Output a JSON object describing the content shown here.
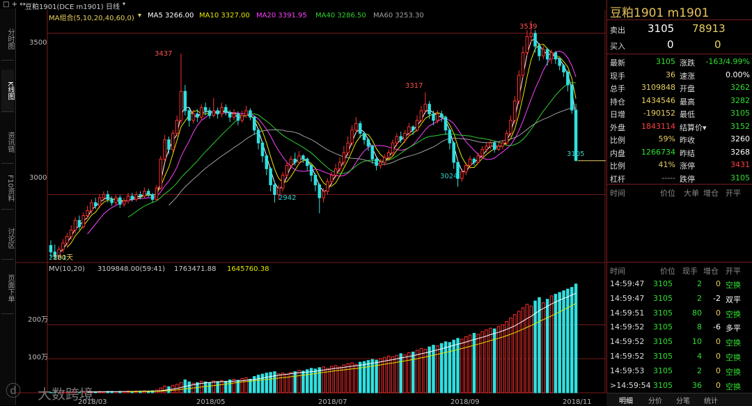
{
  "window": {
    "title": "豆粕1901(DCE m1901)",
    "period": "日线",
    "controls": [
      "□",
      "+",
      "↔"
    ]
  },
  "left_tabs": [
    "分时图",
    "K线图",
    "资讯链",
    "F10资料",
    "讨论区",
    "页面下单"
  ],
  "ma_legend": {
    "group": "MA组合(5,10,20,40,60,0)",
    "items": [
      {
        "label": "MA5 3266.00",
        "color": "#ffffff"
      },
      {
        "label": "MA10 3327.00",
        "color": "#e6e600"
      },
      {
        "label": "MA20 3391.95",
        "color": "#ff40ff"
      },
      {
        "label": "MA40 3286.50",
        "color": "#30d030"
      },
      {
        "label": "MA60 3253.30",
        "color": "#a0a0a0"
      }
    ]
  },
  "price_axis": [
    "3500",
    "3000"
  ],
  "volume_axis": [
    "200万",
    "100万"
  ],
  "x_axis": [
    "2018/03",
    "2018/05",
    "2018/07",
    "2018/09",
    "2018/11"
  ],
  "annotations": {
    "max": "3539",
    "high1": "3437",
    "high2": "3317",
    "low1": "2942",
    "low2": "3024",
    "last": "3105",
    "start": "2801",
    "overlay": "180天"
  },
  "vol_legend": {
    "title": "MV(10,20)",
    "v1": "3109848.00(59:41)",
    "v2": "1763471.88",
    "v3": "1645760.38"
  },
  "panel": {
    "title": "豆粕1901  m1901",
    "sell": {
      "label": "卖出",
      "price": "3105",
      "qty": "78913"
    },
    "buy": {
      "label": "买入",
      "price": "0",
      "qty": "0"
    },
    "stats": [
      {
        "l1": "最新",
        "v1": "3105",
        "c1": "#30e030",
        "l2": "涨跌",
        "v2": "-163/4.99%",
        "c2": "#30e030"
      },
      {
        "l1": "现手",
        "v1": "36",
        "c1": "#e8d060",
        "l2": "速涨",
        "v2": "0.00%",
        "c2": "#ffffff"
      },
      {
        "l1": "总手",
        "v1": "3109848",
        "c1": "#e8d060",
        "l2": "开盘",
        "v2": "3262",
        "c2": "#30e030"
      },
      {
        "l1": "持仓",
        "v1": "1434546",
        "c1": "#e8d060",
        "l2": "最高",
        "v2": "3282",
        "c2": "#30e030"
      },
      {
        "l1": "日增",
        "v1": "-190152",
        "c1": "#e8d060",
        "l2": "最低",
        "v2": "3105",
        "c2": "#30e030"
      },
      {
        "l1": "外盘",
        "v1": "1843114",
        "c1": "#ff4040",
        "l2": "结算价▾",
        "v2": "3152",
        "c2": "#30e030"
      },
      {
        "l1": "比例",
        "v1": "59%",
        "c1": "#e8d060",
        "l2": "昨收",
        "v2": "3260",
        "c2": "#ffffff"
      },
      {
        "l1": "内盘",
        "v1": "1266734",
        "c1": "#30e030",
        "l2": "昨结",
        "v2": "3268",
        "c2": "#ffffff"
      },
      {
        "l1": "比例",
        "v1": "41%",
        "c1": "#e8d060",
        "l2": "涨停",
        "v2": "3431",
        "c2": "#ff4040"
      },
      {
        "l1": "杠杆",
        "v1": "-----",
        "c1": "#aaaaaa",
        "l2": "跌停",
        "v2": "3105",
        "c2": "#30e030"
      }
    ],
    "big_header": [
      "时间",
      "价位",
      "大单",
      "增仓",
      "开平"
    ],
    "tick_header": [
      "时间",
      "价位",
      "现手",
      "增仓",
      "开平"
    ],
    "ticks": [
      {
        "time": "14:59:47",
        "price": "3105",
        "qty": "2",
        "oi": "0",
        "type": "空换",
        "oc": "#e8d060",
        "tc": "#30e030"
      },
      {
        "time": "14:59:47",
        "price": "3105",
        "qty": "2",
        "oi": "-2",
        "type": "双平",
        "oc": "#ffffff",
        "tc": "#ffffff"
      },
      {
        "time": "14:59:51",
        "price": "3105",
        "qty": "80",
        "oi": "0",
        "type": "空换",
        "oc": "#e8d060",
        "tc": "#30e030"
      },
      {
        "time": "14:59:52",
        "price": "3105",
        "qty": "8",
        "oi": "-6",
        "type": "多平",
        "oc": "#ffffff",
        "tc": "#ffffff"
      },
      {
        "time": "14:59:52",
        "price": "3105",
        "qty": "10",
        "oi": "0",
        "type": "空换",
        "oc": "#e8d060",
        "tc": "#30e030"
      },
      {
        "time": "14:59:52",
        "price": "3105",
        "qty": "4",
        "oi": "0",
        "type": "空换",
        "oc": "#e8d060",
        "tc": "#30e030"
      },
      {
        "time": "14:59:53",
        "price": "3105",
        "qty": "2",
        "oi": "0",
        "type": "空换",
        "oc": "#e8d060",
        "tc": "#30e030"
      },
      {
        "time": ">14:59:54",
        "price": "3105",
        "qty": "36",
        "oi": "0",
        "type": "空换",
        "oc": "#e8d060",
        "tc": "#30e030"
      }
    ],
    "bottom_tabs": [
      "明细",
      "分价",
      "分笔",
      "统计"
    ]
  },
  "watermark": "大数跨境",
  "chart_data": {
    "type": "candlestick",
    "price_range": [
      2800,
      3560
    ],
    "volume_unit": "万",
    "start": "2018/02",
    "candles": [
      [
        2842,
        2822,
        2858,
        2805
      ],
      [
        2822,
        2808,
        2845,
        2801
      ],
      [
        2808,
        2830,
        2840,
        2800
      ],
      [
        2830,
        2850,
        2862,
        2820
      ],
      [
        2850,
        2870,
        2880,
        2840
      ],
      [
        2870,
        2890,
        2905,
        2860
      ],
      [
        2890,
        2920,
        2930,
        2880
      ],
      [
        2920,
        2900,
        2935,
        2890
      ],
      [
        2900,
        2935,
        2945,
        2895
      ],
      [
        2935,
        2950,
        2965,
        2925
      ],
      [
        2950,
        2975,
        2985,
        2940
      ],
      [
        2975,
        2965,
        2990,
        2955
      ],
      [
        2965,
        2990,
        3000,
        2958
      ],
      [
        2990,
        3000,
        3010,
        2980
      ],
      [
        3000,
        2985,
        3012,
        2975
      ],
      [
        2985,
        2975,
        2995,
        2965
      ],
      [
        2975,
        2990,
        3000,
        2968
      ],
      [
        2990,
        2970,
        2998,
        2958
      ],
      [
        2970,
        2980,
        2990,
        2962
      ],
      [
        2980,
        2995,
        3005,
        2972
      ],
      [
        2995,
        2985,
        3005,
        2978
      ],
      [
        2985,
        3000,
        3010,
        2978
      ],
      [
        3000,
        2995,
        3010,
        2985
      ],
      [
        2995,
        3010,
        3022,
        2990
      ],
      [
        3010,
        3000,
        3018,
        2992
      ],
      [
        3000,
        2985,
        3005,
        2975
      ],
      [
        2985,
        3020,
        3030,
        2980
      ],
      [
        3020,
        3110,
        3120,
        3015
      ],
      [
        3110,
        3170,
        3185,
        3100
      ],
      [
        3170,
        3140,
        3180,
        3125
      ],
      [
        3140,
        3190,
        3200,
        3130
      ],
      [
        3190,
        3230,
        3245,
        3180
      ],
      [
        3230,
        3320,
        3437,
        3220
      ],
      [
        3320,
        3260,
        3340,
        3245
      ],
      [
        3260,
        3230,
        3270,
        3210
      ],
      [
        3230,
        3250,
        3262,
        3220
      ],
      [
        3250,
        3240,
        3265,
        3225
      ],
      [
        3240,
        3270,
        3280,
        3230
      ],
      [
        3270,
        3260,
        3285,
        3245
      ],
      [
        3260,
        3245,
        3270,
        3235
      ],
      [
        3245,
        3260,
        3300,
        3240
      ],
      [
        3260,
        3250,
        3270,
        3235
      ],
      [
        3250,
        3270,
        3285,
        3240
      ],
      [
        3270,
        3255,
        3280,
        3245
      ],
      [
        3255,
        3240,
        3262,
        3225
      ],
      [
        3240,
        3250,
        3265,
        3230
      ],
      [
        3250,
        3230,
        3258,
        3215
      ],
      [
        3230,
        3245,
        3260,
        3222
      ],
      [
        3245,
        3260,
        3275,
        3238
      ],
      [
        3260,
        3240,
        3268,
        3230
      ],
      [
        3240,
        3200,
        3245,
        3185
      ],
      [
        3200,
        3160,
        3205,
        3140
      ],
      [
        3160,
        3120,
        3165,
        3100
      ],
      [
        3120,
        3080,
        3125,
        3060
      ],
      [
        3080,
        3030,
        3085,
        3010
      ],
      [
        3030,
        3000,
        3040,
        2975
      ],
      [
        3000,
        3020,
        3030,
        2985
      ],
      [
        3020,
        3060,
        3070,
        3010
      ],
      [
        3060,
        3090,
        3100,
        3050
      ],
      [
        3090,
        3110,
        3120,
        3080
      ],
      [
        3110,
        3100,
        3130,
        3090
      ],
      [
        3100,
        3120,
        3135,
        3095
      ],
      [
        3120,
        3110,
        3125,
        3098
      ],
      [
        3110,
        3090,
        3115,
        3075
      ],
      [
        3090,
        3060,
        3095,
        3040
      ],
      [
        3060,
        3030,
        3065,
        3010
      ],
      [
        3030,
        2990,
        3035,
        2942
      ],
      [
        2990,
        3010,
        3020,
        2975
      ],
      [
        3010,
        3040,
        3050,
        3000
      ],
      [
        3040,
        3060,
        3070,
        3030
      ],
      [
        3060,
        3080,
        3095,
        3050
      ],
      [
        3080,
        3100,
        3115,
        3070
      ],
      [
        3100,
        3130,
        3150,
        3090
      ],
      [
        3130,
        3160,
        3180,
        3120
      ],
      [
        3160,
        3200,
        3215,
        3150
      ],
      [
        3200,
        3220,
        3240,
        3190
      ],
      [
        3220,
        3190,
        3228,
        3175
      ],
      [
        3190,
        3170,
        3195,
        3155
      ],
      [
        3170,
        3150,
        3175,
        3135
      ],
      [
        3150,
        3110,
        3155,
        3095
      ],
      [
        3110,
        3090,
        3115,
        3075
      ],
      [
        3090,
        3100,
        3110,
        3080
      ],
      [
        3100,
        3115,
        3125,
        3090
      ],
      [
        3115,
        3130,
        3140,
        3105
      ],
      [
        3130,
        3160,
        3170,
        3120
      ],
      [
        3160,
        3180,
        3190,
        3150
      ],
      [
        3180,
        3170,
        3195,
        3160
      ],
      [
        3170,
        3190,
        3200,
        3160
      ],
      [
        3190,
        3210,
        3222,
        3180
      ],
      [
        3210,
        3200,
        3215,
        3185
      ],
      [
        3200,
        3230,
        3245,
        3195
      ],
      [
        3230,
        3260,
        3275,
        3225
      ],
      [
        3260,
        3280,
        3317,
        3250
      ],
      [
        3280,
        3250,
        3290,
        3235
      ],
      [
        3250,
        3230,
        3260,
        3215
      ],
      [
        3230,
        3250,
        3262,
        3220
      ],
      [
        3250,
        3240,
        3260,
        3225
      ],
      [
        3240,
        3200,
        3245,
        3185
      ],
      [
        3200,
        3160,
        3205,
        3140
      ],
      [
        3160,
        3100,
        3165,
        3080
      ],
      [
        3100,
        3050,
        3105,
        3024
      ],
      [
        3050,
        3070,
        3080,
        3040
      ],
      [
        3070,
        3090,
        3100,
        3060
      ],
      [
        3090,
        3110,
        3120,
        3080
      ],
      [
        3110,
        3100,
        3115,
        3090
      ],
      [
        3100,
        3120,
        3130,
        3095
      ],
      [
        3120,
        3140,
        3150,
        3110
      ],
      [
        3140,
        3150,
        3160,
        3130
      ],
      [
        3150,
        3160,
        3170,
        3140
      ],
      [
        3160,
        3140,
        3165,
        3130
      ],
      [
        3140,
        3150,
        3160,
        3135
      ],
      [
        3150,
        3160,
        3170,
        3140
      ],
      [
        3160,
        3190,
        3200,
        3150
      ],
      [
        3190,
        3230,
        3245,
        3180
      ],
      [
        3230,
        3290,
        3305,
        3220
      ],
      [
        3290,
        3370,
        3385,
        3280
      ],
      [
        3370,
        3440,
        3460,
        3360
      ],
      [
        3440,
        3490,
        3510,
        3430
      ],
      [
        3490,
        3500,
        3539,
        3470
      ],
      [
        3500,
        3460,
        3510,
        3440
      ],
      [
        3460,
        3430,
        3470,
        3415
      ],
      [
        3430,
        3450,
        3462,
        3420
      ],
      [
        3450,
        3420,
        3455,
        3400
      ],
      [
        3420,
        3440,
        3450,
        3405
      ],
      [
        3440,
        3420,
        3445,
        3405
      ],
      [
        3420,
        3400,
        3425,
        3385
      ],
      [
        3400,
        3380,
        3405,
        3365
      ],
      [
        3380,
        3340,
        3385,
        3320
      ],
      [
        3340,
        3262,
        3345,
        3250
      ],
      [
        3262,
        3105,
        3282,
        3105
      ]
    ],
    "volumes": [
      1,
      2,
      1,
      2,
      2,
      2,
      3,
      2,
      3,
      3,
      3,
      3,
      4,
      3,
      4,
      4,
      3,
      4,
      4,
      5,
      4,
      5,
      5,
      6,
      5,
      6,
      8,
      14,
      20,
      18,
      22,
      25,
      30,
      38,
      32,
      28,
      30,
      34,
      32,
      30,
      35,
      33,
      36,
      34,
      38,
      40,
      37,
      42,
      44,
      40,
      48,
      52,
      55,
      58,
      60,
      62,
      56,
      58,
      55,
      60,
      62,
      66,
      64,
      68,
      72,
      70,
      74,
      76,
      72,
      78,
      80,
      76,
      82,
      85,
      88,
      84,
      90,
      92,
      95,
      98,
      96,
      100,
      104,
      108,
      106,
      110,
      115,
      112,
      118,
      120,
      125,
      130,
      128,
      135,
      140,
      138,
      145,
      150,
      148,
      155,
      160,
      158,
      165,
      170,
      175,
      172,
      180,
      185,
      190,
      188,
      195,
      200,
      210,
      220,
      230,
      240,
      250,
      260,
      255,
      270,
      280,
      265,
      275,
      285,
      290,
      295,
      300,
      305,
      310,
      320
    ]
  }
}
